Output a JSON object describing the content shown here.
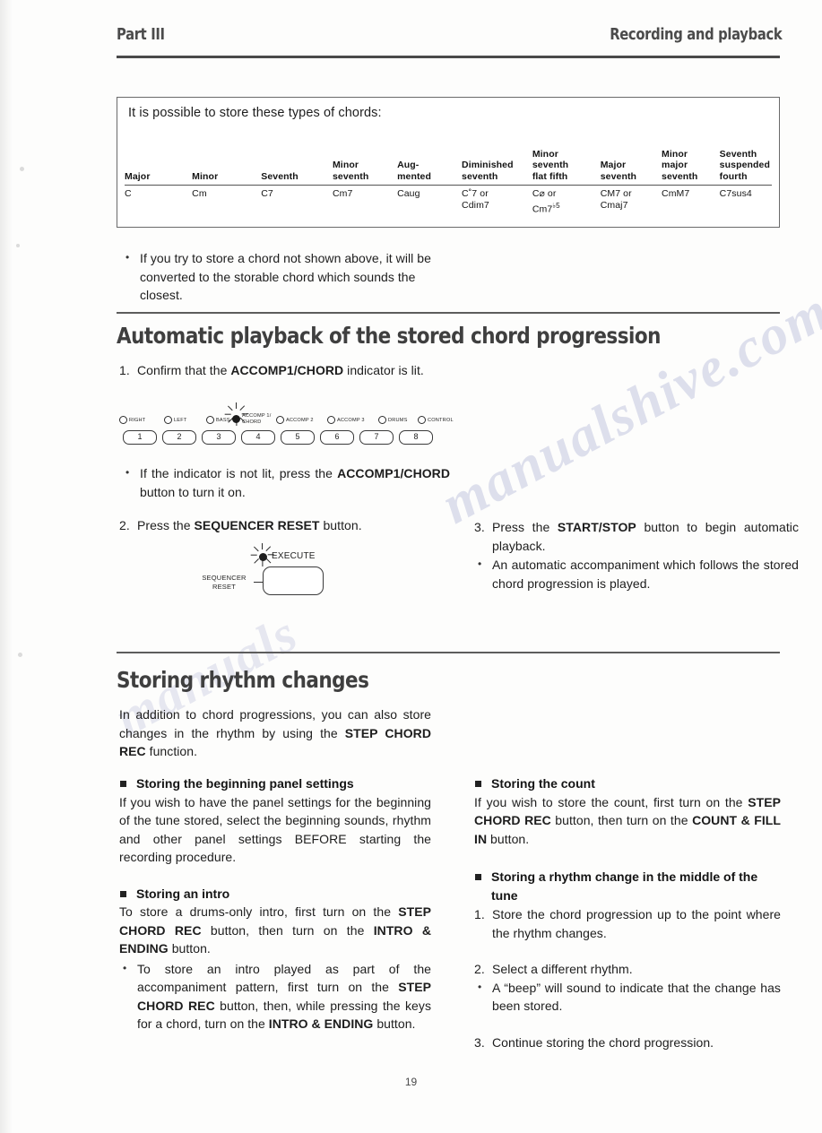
{
  "header": {
    "left": "Part III",
    "right": "Recording and playback"
  },
  "chord_table": {
    "caption": "It is possible to store these types of chords:",
    "columns": [
      "Major",
      "Minor",
      "Seventh",
      "Minor seventh",
      "Aug- mented",
      "Diminished seventh",
      "Minor seventh flat fifth",
      "Major seventh",
      "Minor major seventh",
      "Seventh suspended fourth"
    ],
    "headers": [
      {
        "l1": "",
        "l2": "",
        "l3": "Major"
      },
      {
        "l1": "",
        "l2": "",
        "l3": "Minor"
      },
      {
        "l1": "",
        "l2": "",
        "l3": "Seventh"
      },
      {
        "l1": "",
        "l2": "Minor",
        "l3": "seventh"
      },
      {
        "l1": "",
        "l2": "Aug-",
        "l3": "mented"
      },
      {
        "l1": "",
        "l2": "Diminished",
        "l3": "seventh"
      },
      {
        "l1": "Minor",
        "l2": "seventh",
        "l3": "flat fifth"
      },
      {
        "l1": "",
        "l2": "Major",
        "l3": "seventh"
      },
      {
        "l1": "Minor",
        "l2": "major",
        "l3": "seventh"
      },
      {
        "l1": "Seventh",
        "l2": "suspended",
        "l3": "fourth"
      }
    ],
    "values": [
      {
        "l1": "C",
        "l2": ""
      },
      {
        "l1": "Cm",
        "l2": ""
      },
      {
        "l1": "C7",
        "l2": ""
      },
      {
        "l1": "Cm7",
        "l2": ""
      },
      {
        "l1": "Caug",
        "l2": ""
      },
      {
        "l1": "C˚7 or",
        "l2": "Cdim7"
      },
      {
        "l1": "C⌀ or",
        "l2": "Cm7",
        "sup": "♭5"
      },
      {
        "l1": "CM7 or",
        "l2": "Cmaj7"
      },
      {
        "l1": "CmM7",
        "l2": ""
      },
      {
        "l1": "C7sus4",
        "l2": ""
      }
    ]
  },
  "note_after_table": {
    "bullet": "•",
    "text": "If you try to store a chord not shown above, it will be converted to the storable chord which sounds the closest."
  },
  "section_playback": {
    "heading": "Automatic playback of the stored chord progression",
    "step1": {
      "marker": "1.",
      "before": "Confirm that the ",
      "bold": "ACCOMP1/CHORD",
      "after": " indicator is lit."
    },
    "panel": {
      "indicators": [
        {
          "label_line1": "RIGHT",
          "label_line2": "",
          "lit": false,
          "button": "1"
        },
        {
          "label_line1": "LEFT",
          "label_line2": "",
          "lit": false,
          "button": "2"
        },
        {
          "label_line1": "BASS",
          "label_line2": "",
          "lit": false,
          "button": "3"
        },
        {
          "label_line1": "ACCOMP 1/",
          "label_line2": "CHORD",
          "lit": true,
          "button": "4"
        },
        {
          "label_line1": "ACCOMP 2",
          "label_line2": "",
          "lit": false,
          "button": "5"
        },
        {
          "label_line1": "ACCOMP 3",
          "label_line2": "",
          "lit": false,
          "button": "6"
        },
        {
          "label_line1": "DRUMS",
          "label_line2": "",
          "lit": false,
          "button": "7"
        },
        {
          "label_line1": "CONTROL",
          "label_line2": "",
          "lit": false,
          "button": "8"
        }
      ]
    },
    "bullet_not_lit": {
      "bullet": "•",
      "before": "If the indicator is not lit, press the ",
      "bold": "ACCOMP1/CHORD",
      "after": " button to turn it on."
    },
    "step2": {
      "marker": "2.",
      "before": "Press the ",
      "bold": "SEQUENCER RESET",
      "after": " button."
    },
    "seq_diagram": {
      "label_line1": "SEQUENCER",
      "label_line2": "RESET",
      "led_label": "EXECUTE"
    },
    "step3": {
      "marker": "3.",
      "before": "Press the ",
      "bold": "START/STOP",
      "after": " button to begin automatic playback."
    },
    "bullet_auto": {
      "bullet": "•",
      "text": "An automatic accompaniment which follows the stored chord progression is played."
    }
  },
  "section_rhythm": {
    "heading": "Storing rhythm changes",
    "intro": {
      "before": "In addition to chord progressions, you can also store changes in the rhythm by using the ",
      "bold": "STEP CHORD REC",
      "after": " function."
    },
    "left_col": {
      "sub1": {
        "heading": "Storing the beginning panel settings",
        "text": "If you wish to have the panel settings for the beginning of the tune stored, select the beginning sounds, rhythm and other panel settings BEFORE starting the recording procedure."
      },
      "sub2": {
        "heading": "Storing an intro",
        "p1_a": "To store a drums-only intro, first turn on the ",
        "p1_b1": "STEP CHORD REC",
        "p1_c": " button, then turn on the ",
        "p1_b2": "INTRO & ENDING",
        "p1_d": " button.",
        "bullet": {
          "mark": "•",
          "a": "To store an intro played as part of the accompaniment pattern, first turn on the ",
          "b1": "STEP CHORD REC",
          "c": " button, then, while pressing the keys for a chord, turn on the ",
          "b2": "INTRO & ENDING",
          "d": " button."
        }
      }
    },
    "right_col": {
      "sub1": {
        "heading": "Storing the count",
        "a": "If you wish to store the count, first turn on the ",
        "b1": "STEP CHORD REC",
        "c": " button, then turn on the ",
        "b2": "COUNT & FILL IN",
        "d": "  button."
      },
      "sub2": {
        "heading": "Storing a rhythm change in the middle of the tune",
        "step1": {
          "marker": "1.",
          "text": "Store the chord progression up to the point where the rhythm changes."
        },
        "step2": {
          "marker": "2.",
          "text": "Select a different rhythm."
        },
        "bullet": {
          "mark": "•",
          "text": "A “beep” will sound to indicate that the change has been stored."
        },
        "step3": {
          "marker": "3.",
          "text": "Continue storing the chord progression."
        }
      }
    }
  },
  "page_number": "19",
  "watermarks": [
    "manualshive.com",
    "manuals"
  ]
}
